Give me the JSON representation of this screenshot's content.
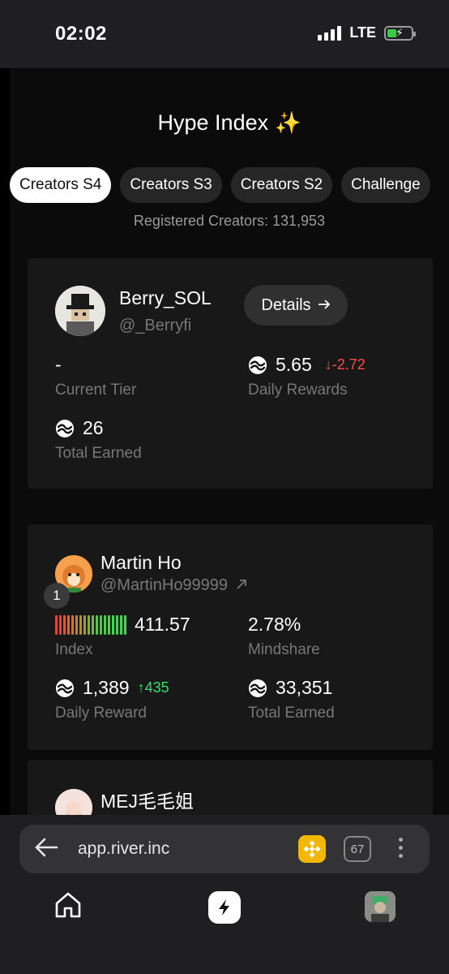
{
  "status": {
    "time": "02:02",
    "network": "LTE"
  },
  "header": {
    "title": "Hype Index"
  },
  "tabs": [
    {
      "label": "Creators S4",
      "active": true
    },
    {
      "label": "Creators S3",
      "active": false
    },
    {
      "label": "Creators S2",
      "active": false
    },
    {
      "label": "Challenge",
      "active": false
    }
  ],
  "registered": "Registered Creators: 131,953",
  "my_card": {
    "name": "Berry_SOL",
    "handle": "@_Berryfi",
    "details_label": "Details",
    "tier_value": "-",
    "tier_label": "Current Tier",
    "daily_value": "5.65",
    "daily_delta": "-2.72",
    "daily_label": "Daily Rewards",
    "total_value": "26",
    "total_label": "Total Earned"
  },
  "leaders": [
    {
      "rank": "1",
      "name": "Martin Ho",
      "handle": "@MartinHo99999",
      "index_value": "411.57",
      "index_label": "Index",
      "mindshare_value": "2.78%",
      "mindshare_label": "Mindshare",
      "daily_value": "1,389",
      "daily_delta": "435",
      "daily_label": "Daily Reward",
      "total_value": "33,351",
      "total_label": "Total Earned"
    },
    {
      "name": "MEJ毛毛姐"
    }
  ],
  "browser": {
    "url": "app.river.inc",
    "tab_count": "67"
  },
  "colors": {
    "accent": "#b47cff",
    "down": "#ff4b4b",
    "up": "#2fe26b",
    "card": "#181818"
  }
}
